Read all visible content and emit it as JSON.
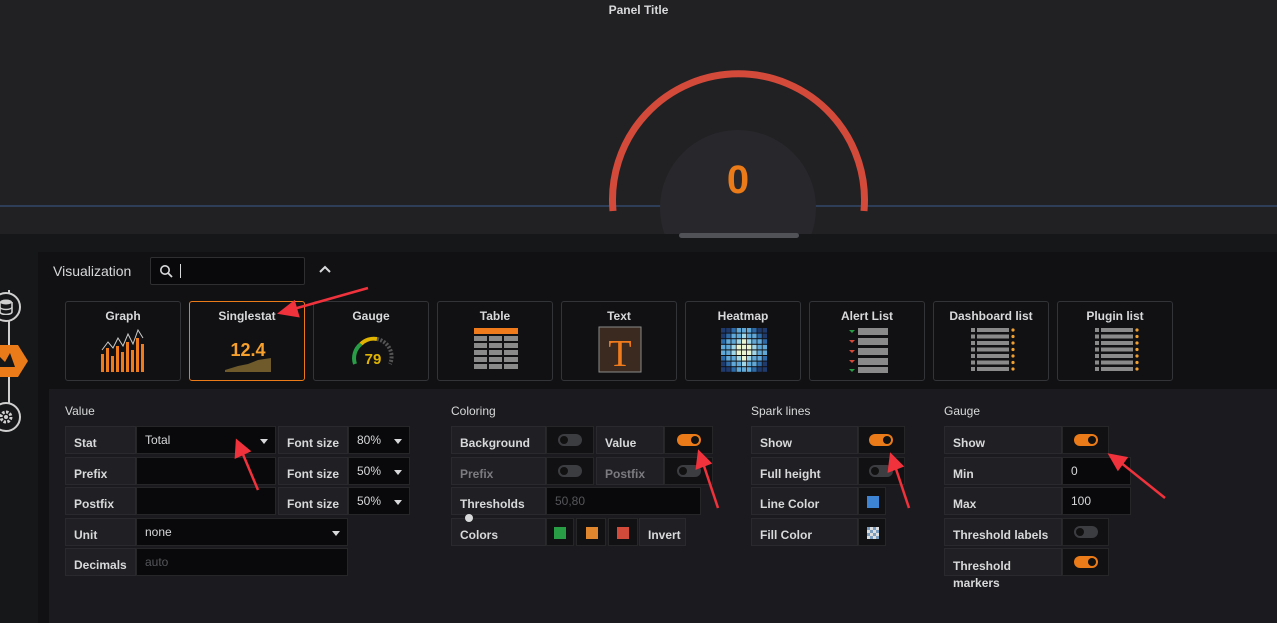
{
  "panel": {
    "title": "Panel Title",
    "gauge_value": "0"
  },
  "visualization": {
    "label": "Visualization",
    "search_value": "",
    "types": [
      {
        "name": "Graph"
      },
      {
        "name": "Singlestat",
        "selected": true,
        "thumb_text": "12.4"
      },
      {
        "name": "Gauge",
        "thumb_text": "79"
      },
      {
        "name": "Table"
      },
      {
        "name": "Text",
        "thumb_text": "T"
      },
      {
        "name": "Heatmap"
      },
      {
        "name": "Alert List"
      },
      {
        "name": "Dashboard list"
      },
      {
        "name": "Plugin list"
      }
    ]
  },
  "value_section": {
    "title": "Value",
    "stat_label": "Stat",
    "stat_value": "Total",
    "prefix_label": "Prefix",
    "postfix_label": "Postfix",
    "font_size_label": "Font size",
    "font_size_value": "80%",
    "prefix_font_size": "50%",
    "postfix_font_size": "50%",
    "unit_label": "Unit",
    "unit_value": "none",
    "decimals_label": "Decimals",
    "decimals_placeholder": "auto"
  },
  "coloring": {
    "title": "Coloring",
    "background_label": "Background",
    "background_on": false,
    "value_label": "Value",
    "value_on": true,
    "prefix_label": "Prefix",
    "prefix_on": false,
    "postfix_label": "Postfix",
    "postfix_on": false,
    "thresholds_label": "Thresholds",
    "thresholds_placeholder": "50,80",
    "colors_label": "Colors",
    "invert_label": "Invert",
    "colors": [
      "#299c46",
      "#e0862e",
      "#d44a3a"
    ]
  },
  "spark_lines": {
    "title": "Spark lines",
    "show_label": "Show",
    "show_on": true,
    "full_height_label": "Full height",
    "full_height_on": false,
    "line_color_label": "Line Color",
    "line_color": "#3d84d4",
    "fill_color_label": "Fill Color"
  },
  "gauge": {
    "title": "Gauge",
    "show_label": "Show",
    "show_on": true,
    "min_label": "Min",
    "min_value": "0",
    "max_label": "Max",
    "max_value": "100",
    "threshold_labels_label": "Threshold labels",
    "threshold_labels_on": false,
    "threshold_markers_label": "Threshold markers",
    "threshold_markers_on": true
  },
  "colors": {
    "accent": "#eb7b18",
    "gauge_arc": "#d44a3a",
    "annotation_arrow": "#f0323c"
  }
}
